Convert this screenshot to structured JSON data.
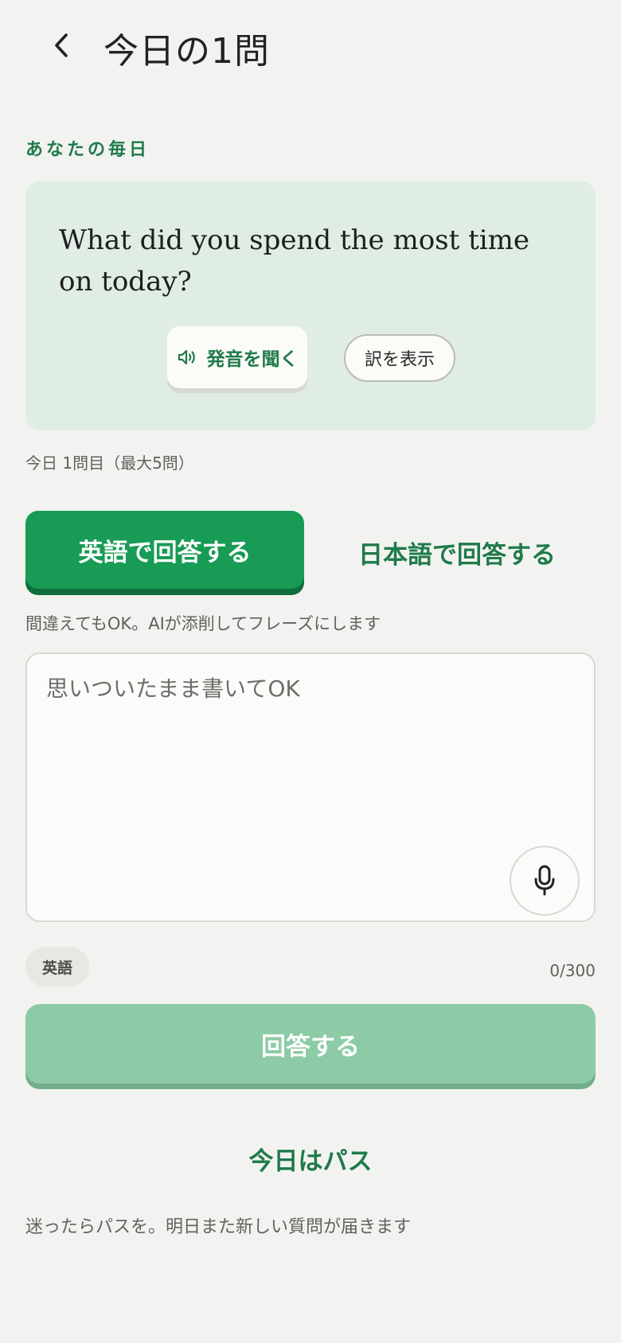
{
  "header": {
    "title": "今日の1問",
    "back_icon": "chevron-left-icon"
  },
  "question": {
    "section_label": "あなたの毎日",
    "text": "What did you spend the most time on today?",
    "listen_label": "発音を聞く",
    "listen_icon": "speaker-icon",
    "translate_label": "訳を表示"
  },
  "progress": {
    "text": "今日 1問目（最大5問）"
  },
  "mode": {
    "english_label": "英語で回答する",
    "japanese_label": "日本語で回答する",
    "selected": "english"
  },
  "answer": {
    "hint": "間違えてもOK。AIが添削してフレーズにします",
    "placeholder": "思いついたまま書いてOK",
    "value": "",
    "mic_icon": "microphone-icon",
    "language_chip": "英語",
    "char_count": "0/300"
  },
  "actions": {
    "submit_label": "回答する",
    "pass_label": "今日はパス",
    "pass_hint": "迷ったらパスを。明日また新しい質問が届きます"
  },
  "colors": {
    "accent": "#189b55",
    "accent_text": "#1f7a4a",
    "card_bg": "#dfede4",
    "submit_disabled": "#8ccba5",
    "page_bg": "#f2f3f0"
  }
}
